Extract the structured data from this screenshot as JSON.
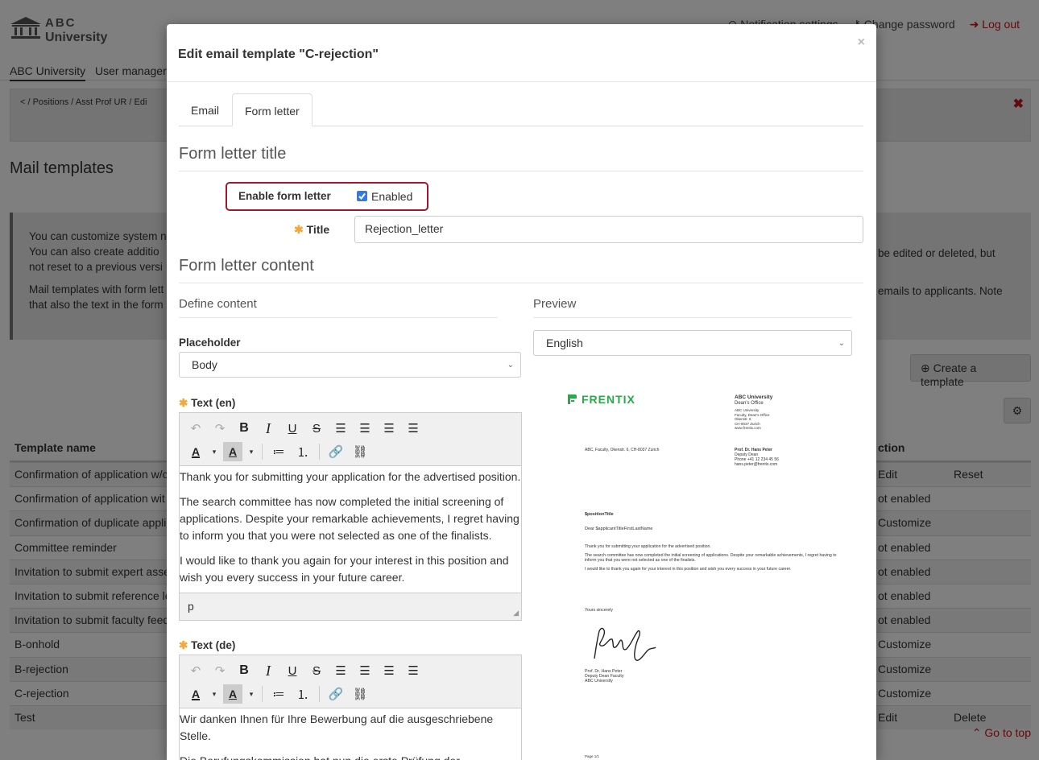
{
  "app": {
    "logo_line1": "ABC",
    "logo_line2": "University",
    "top_links": {
      "notifications": "Notification settings",
      "change_password": "Change password",
      "logout": "Log out"
    },
    "nav": {
      "home": "ABC University",
      "users": "User manager"
    },
    "breadcrumb": "< / Positions / Asst Prof UR / Edi",
    "page_title": "Mail templates",
    "info": {
      "p1_l1": "You can customize system n",
      "p1_l2": "You can also create additio",
      "p1_l3": "not reset to a previous versi",
      "p2_l1": "Mail templates with form lett",
      "p2_l2": "that also the text in the form",
      "right_l1": "be edited or deleted, but",
      "right_l2": "emails to applicants. Note"
    },
    "create_button": "Create a template",
    "table": {
      "col_name": "Template name",
      "col_action": "ction",
      "rows": [
        {
          "name": "Confirmation of application w/c",
          "action": "Edit",
          "action2": "Reset"
        },
        {
          "name": "Confirmation of application wit",
          "action": "ot enabled",
          "action2": ""
        },
        {
          "name": "Confirmation of duplicate appli",
          "action": "Customize",
          "action2": ""
        },
        {
          "name": "Committee reminder",
          "action": "ot enabled",
          "action2": ""
        },
        {
          "name": "Invitation to submit expert asse",
          "action": "ot enabled",
          "action2": ""
        },
        {
          "name": "Invitation to submit reference le",
          "action": "ot enabled",
          "action2": ""
        },
        {
          "name": "Invitation to submit faculty feed",
          "action": "ot enabled",
          "action2": ""
        },
        {
          "name": "B-onhold",
          "action": "Customize",
          "action2": ""
        },
        {
          "name": "B-rejection",
          "action": "Customize",
          "action2": ""
        },
        {
          "name": "C-rejection",
          "action": "Customize",
          "action2": ""
        },
        {
          "name": "Test",
          "action": "Edit",
          "action2": "Delete"
        }
      ]
    },
    "go_to_top": "Go to top"
  },
  "modal": {
    "title": "Edit email template \"C-rejection\"",
    "close": "×",
    "tabs": {
      "email": "Email",
      "form_letter": "Form letter"
    },
    "section_title": "Form letter title",
    "enable_label": "Enable form letter",
    "enabled_checkbox_label": "Enabled",
    "enabled": true,
    "title_label": "Title",
    "title_value": "Rejection_letter",
    "content_title": "Form letter content",
    "define_content": "Define content",
    "preview_label": "Preview",
    "placeholder_label": "Placeholder",
    "placeholder_value": "Body",
    "language_value": "English",
    "text_en_label": "Text (en)",
    "text_de_label": "Text (de)",
    "text_en": {
      "p1": "Thank you for submitting your application for the advertised position.",
      "p2": "The search committee has now completed the initial screening of applications. Despite your remarkable achievements, I regret having to inform you that you were not selected as one of the finalists.",
      "p3": "I would like to thank you again for your interest in this position and wish you every success in your future career.",
      "status": "p"
    },
    "text_de": {
      "p1": "Wir danken Ihnen für Ihre Bewerbung auf die ausgeschriebene Stelle.",
      "p2": "Die Berufungskommission hat nun die erste Prüfung der Bewerbungen abgeschlossen. Ich bedauere, Ihnen mitteilen zu"
    },
    "letter": {
      "brand": "FRENTIX",
      "sender_name": "ABC University",
      "sender_office": "Dean's Office",
      "sender_addr1": "ABC University",
      "sender_addr2": "Faculty, Dean's Office",
      "sender_addr3": "Okenstr. 6",
      "sender_addr4": "CH-8037 Zurich",
      "sender_addr5": "www.frentix.com",
      "return_address": "ABC, Faculty, Okenstr. 6, CH-8037 Zurich",
      "person_name": "Prof. Dr. Hans Peter",
      "person_role": "Deputy Dean",
      "person_phone": "Phone +41 12 234 45 56",
      "person_email": "hans.peter@frentix.com",
      "position_title": "$positionTitle",
      "salutation": "Dear $applicantTitleFirstLastName",
      "body_p1": "Thank you for submitting your application for the advertised position.",
      "body_p2": "The search committee has now completed the initial screening of applications. Despite your remarkable achievements, I regret having to inform you that you were not selected as one of the finalists.",
      "body_p3": "I would like to thank you again for your interest in this position and wish you every success in your future career.",
      "closing": "Yours sincerely",
      "signer_name": "Prof. Dr. Hans Peter",
      "signer_role": "Deputy Dean Faculty",
      "signer_org": "ABC University",
      "page": "Page 1/1"
    }
  },
  "colors": {
    "accent_red": "#c0161c",
    "highlight_border": "#a3182e",
    "required_star": "#f0a93a",
    "checkbox": "#2f7be4",
    "brand_green": "#2aa84a"
  }
}
